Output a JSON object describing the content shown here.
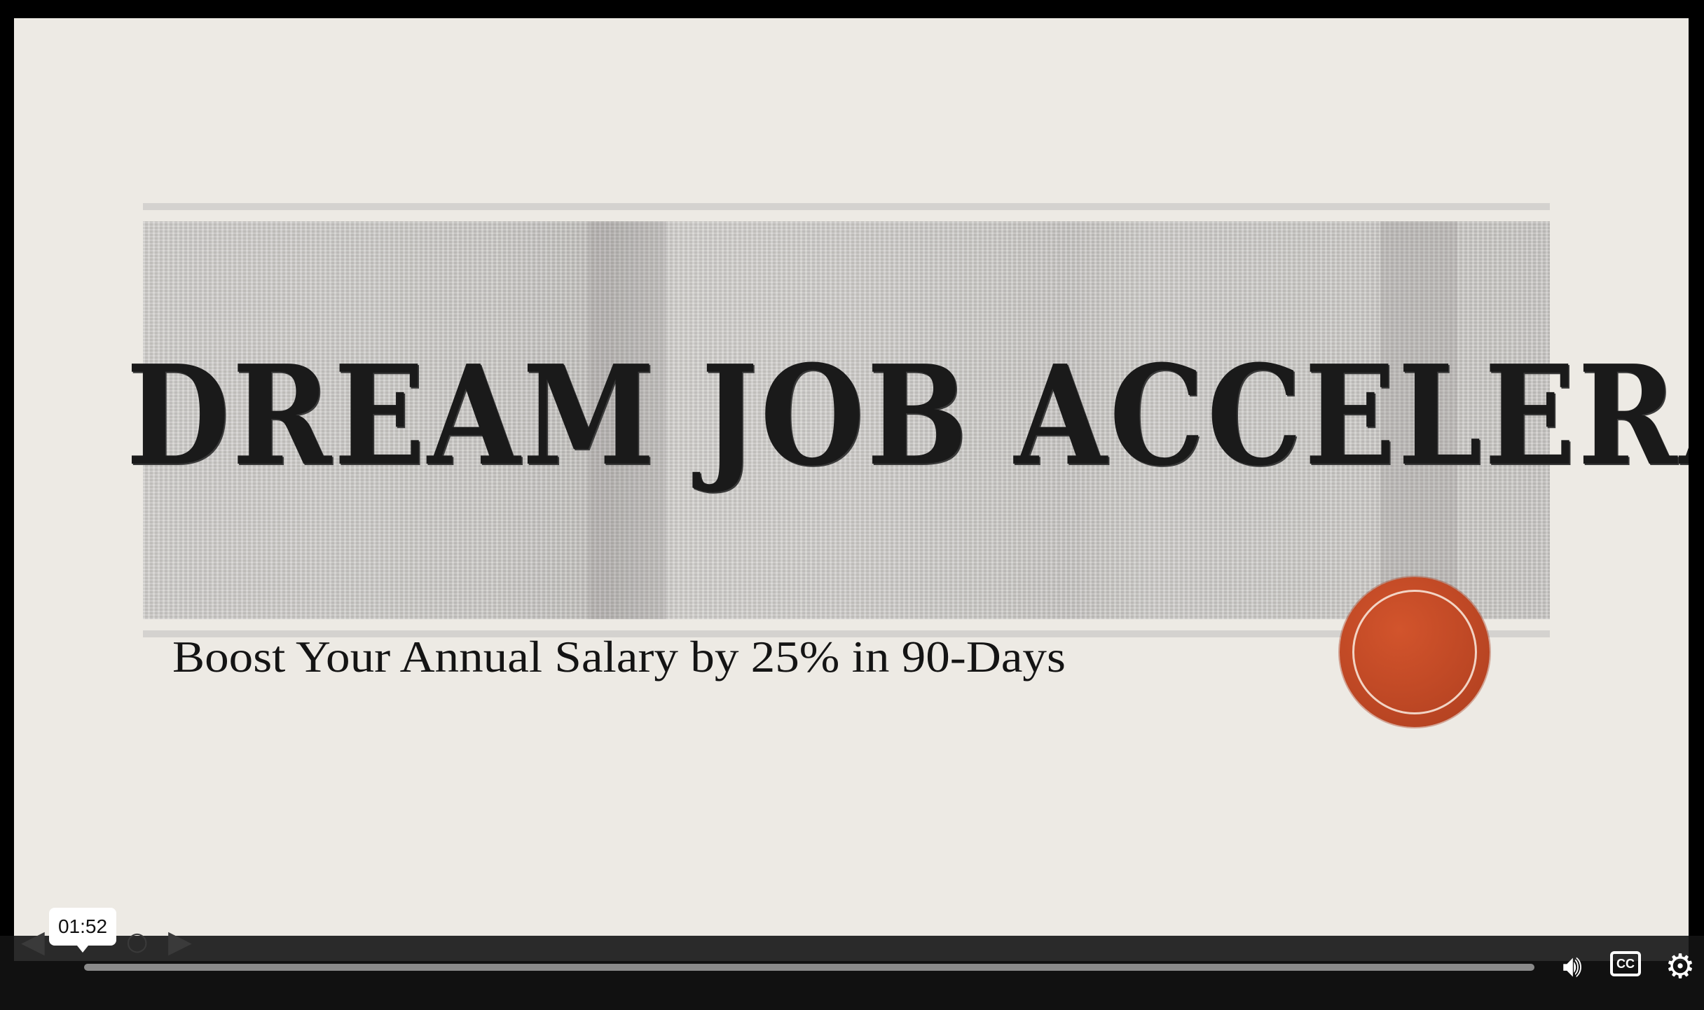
{
  "slide": {
    "title": "DREAM JOB ACCELERATOR",
    "subtitle": "Boost Your Annual Salary by 25% in 90-Days",
    "colors": {
      "background": "#edeae4",
      "banner": "#c8c6c3",
      "badge": "#c24a26",
      "title_text": "#1a1a1a"
    }
  },
  "player": {
    "timestamp_tooltip": "01:52",
    "progress_fraction": 0.0,
    "captions_label": "CC",
    "icons": {
      "volume": "volume-icon",
      "captions": "closed-captions-icon",
      "settings": "gear-icon",
      "prev": "previous-slide-icon",
      "next": "next-slide-icon"
    }
  }
}
